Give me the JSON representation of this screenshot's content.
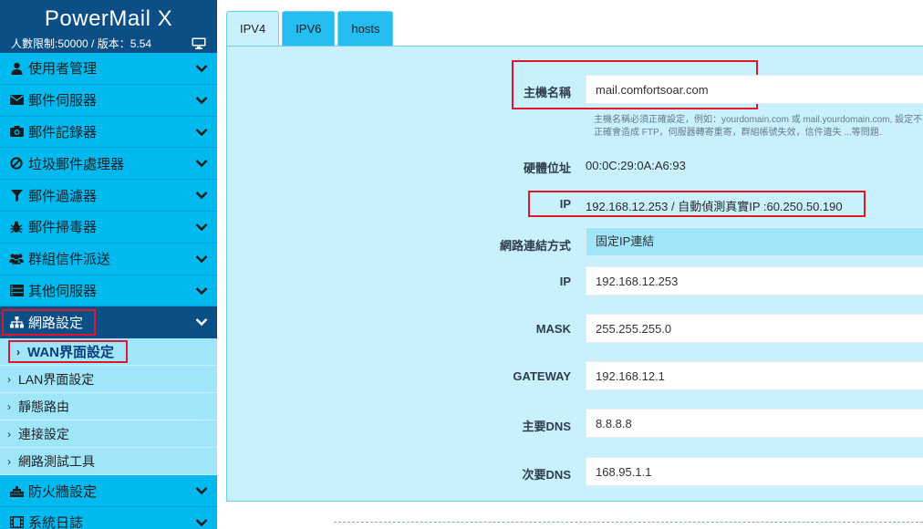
{
  "sidebar": {
    "brand": "PowerMail X",
    "license": "人數限制:50000 / 版本：5.54",
    "items": [
      {
        "label": "使用者管理",
        "icon": "user-icon"
      },
      {
        "label": "郵件伺服器",
        "icon": "envelope-icon"
      },
      {
        "label": "郵件記錄器",
        "icon": "camera-icon"
      },
      {
        "label": "垃圾郵件處理器",
        "icon": "ban-icon"
      },
      {
        "label": "郵件過濾器",
        "icon": "filter-icon"
      },
      {
        "label": "郵件掃毒器",
        "icon": "bug-icon"
      },
      {
        "label": "群組信件派送",
        "icon": "users-icon"
      },
      {
        "label": "其他伺服器",
        "icon": "server-icon"
      },
      {
        "label": "網路設定",
        "icon": "sitemap-icon"
      }
    ],
    "subitems": [
      "WAN界面設定",
      "LAN界面設定",
      "靜態路由",
      "連接設定",
      "網路測試工具"
    ],
    "tail_items": [
      {
        "label": "防火牆設定",
        "icon": "fire-icon"
      },
      {
        "label": "系統日誌",
        "icon": "film-icon"
      }
    ]
  },
  "tabs": [
    "IPV4",
    "IPV6",
    "hosts"
  ],
  "form": {
    "hostname_label": "主機名稱",
    "hostname_value": "mail.comfortsoar.com",
    "hostname_help": "主機名稱必須正確設定，例如：yourdomain.com 或 mail.yourdomain.com, 設定不正確會造成 FTP，伺服器轉寄重寄，群組帳號失效，信件遺失 ...等問題.",
    "mac_label": "硬體位址",
    "mac_value": "00:0C:29:0A:A6:93",
    "ip_info_label": "IP",
    "ip_info_value": "192.168.12.253 / 自動偵測真實IP :60.250.50.190",
    "conn_label": "網路連結方式",
    "conn_value": "固定IP連結",
    "ip_label": "IP",
    "ip_value": "192.168.12.253",
    "mask_label": "MASK",
    "mask_value": "255.255.255.0",
    "gateway_label": "GATEWAY",
    "gateway_value": "192.168.12.1",
    "dns1_label": "主要DNS",
    "dns1_value": "8.8.8.8",
    "dns2_label": "次要DNS",
    "dns2_value": "168.95.1.1"
  },
  "colors": {
    "sidebar_dark": "#0c4f86",
    "sidebar_item": "#00b9ef",
    "subitem": "#9fe6fb",
    "panel": "#c8f1fd",
    "highlight": "#e2152a"
  }
}
